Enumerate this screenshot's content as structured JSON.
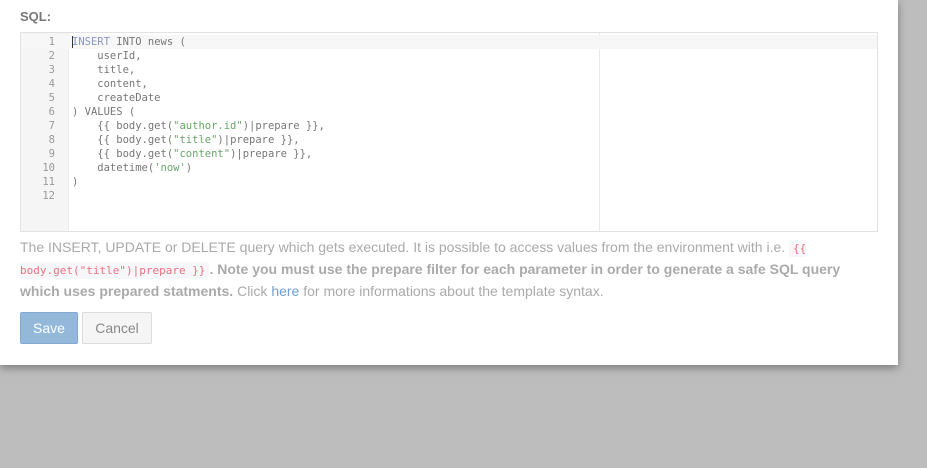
{
  "form": {
    "sql_label": "SQL:",
    "save_label": "Save",
    "cancel_label": "Cancel"
  },
  "editor": {
    "lines": [
      {
        "num": "1",
        "segments": [
          {
            "t": "INSERT",
            "c": "kw"
          },
          {
            "t": " INTO news ("
          }
        ]
      },
      {
        "num": "2",
        "segments": [
          {
            "t": "    userId,"
          }
        ]
      },
      {
        "num": "3",
        "segments": [
          {
            "t": "    title,"
          }
        ]
      },
      {
        "num": "4",
        "segments": [
          {
            "t": "    content,"
          }
        ]
      },
      {
        "num": "5",
        "segments": [
          {
            "t": "    createDate"
          }
        ]
      },
      {
        "num": "6",
        "segments": [
          {
            "t": ") VALUES ("
          }
        ]
      },
      {
        "num": "7",
        "segments": [
          {
            "t": "    {{ body.get("
          },
          {
            "t": "\"author.id\"",
            "c": "str"
          },
          {
            "t": ")|prepare }},"
          }
        ]
      },
      {
        "num": "8",
        "segments": [
          {
            "t": "    {{ body.get("
          },
          {
            "t": "\"title\"",
            "c": "str"
          },
          {
            "t": ")|prepare }},"
          }
        ]
      },
      {
        "num": "9",
        "segments": [
          {
            "t": "    {{ body.get("
          },
          {
            "t": "\"content\"",
            "c": "str"
          },
          {
            "t": ")|prepare }},"
          }
        ]
      },
      {
        "num": "10",
        "segments": [
          {
            "t": "    datetime("
          },
          {
            "t": "'now'",
            "c": "str"
          },
          {
            "t": ")"
          }
        ]
      },
      {
        "num": "11",
        "segments": [
          {
            "t": ")"
          }
        ]
      },
      {
        "num": "12",
        "segments": [
          {
            "t": ""
          }
        ]
      }
    ]
  },
  "help": {
    "intro": "The INSERT, UPDATE or DELETE query which gets executed. It is possible to access values from the environment with i.e.",
    "code_example": "{{ body.get(\"title\")|prepare }}",
    "note": ". Note you must use the prepare filter for each parameter in order to generate a safe SQL query which uses prepared statments.",
    "click": " Click ",
    "link_text": "here",
    "outro": " for more informations about the template syntax."
  },
  "colors": {
    "overlay": "#bdbdbd",
    "keyword": "#8a97c6",
    "string": "#6aa56a",
    "code_highlight": "#e7727f",
    "link": "#6f9fd3",
    "save_button": "#93b8da"
  }
}
